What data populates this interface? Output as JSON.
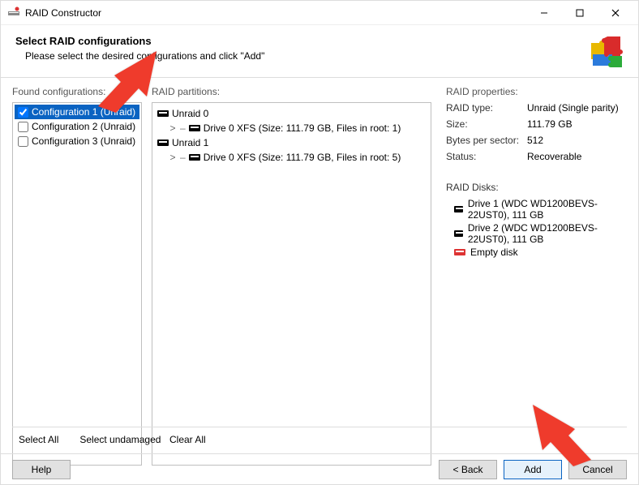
{
  "window": {
    "title": "RAID Constructor"
  },
  "header": {
    "title": "Select RAID configurations",
    "subtitle": "Please select the desired configurations and click \"Add\""
  },
  "labels": {
    "found": "Found configurations:",
    "partitions": "RAID partitions:",
    "properties": "RAID properties:",
    "disks": "RAID Disks:"
  },
  "configs": [
    {
      "label": "Configuration 1 (Unraid)",
      "checked": true,
      "selected": true
    },
    {
      "label": "Configuration 2 (Unraid)",
      "checked": false,
      "selected": false
    },
    {
      "label": "Configuration 3 (Unraid)",
      "checked": false,
      "selected": false
    }
  ],
  "partitions": [
    {
      "label": "Unraid 0",
      "child": "Drive 0 XFS (Size: 111.79 GB, Files in root: 1)"
    },
    {
      "label": "Unraid 1",
      "child": "Drive 0 XFS (Size: 111.79 GB, Files in root: 5)"
    }
  ],
  "properties": {
    "type_label": "RAID type:",
    "type_value": "Unraid (Single parity)",
    "size_label": "Size:",
    "size_value": "111.79 GB",
    "bps_label": "Bytes per sector:",
    "bps_value": "512",
    "status_label": "Status:",
    "status_value": "Recoverable"
  },
  "disks": [
    {
      "label": "Drive 1 (WDC WD1200BEVS-22UST0), 111 GB",
      "empty": false
    },
    {
      "label": "Drive 2 (WDC WD1200BEVS-22UST0), 111 GB",
      "empty": false
    },
    {
      "label": "Empty disk",
      "empty": true
    }
  ],
  "midButtons": {
    "select_all": "Select All",
    "select_undamaged": "Select undamaged",
    "clear_all": "Clear All"
  },
  "footer": {
    "help": "Help",
    "back": "< Back",
    "add": "Add",
    "cancel": "Cancel"
  }
}
